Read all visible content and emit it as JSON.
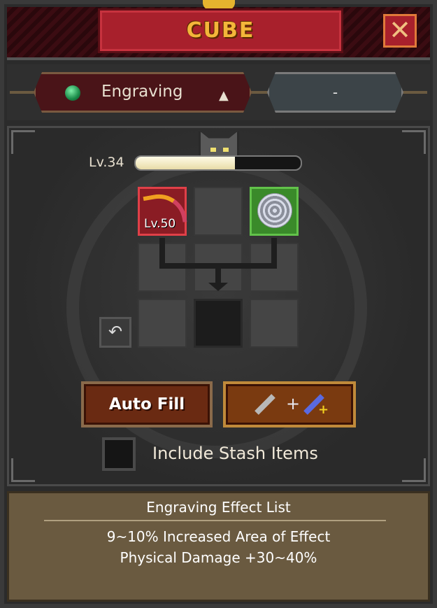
{
  "window": {
    "title": "CUBE",
    "close_icon": "close-icon"
  },
  "selector": {
    "mode_label": "Engraving",
    "mode_icon": "green-gem-icon",
    "mode_arrow": "▲",
    "secondary_label": "-"
  },
  "cube": {
    "level_label": "Lv.34",
    "xp_fraction": 0.6
  },
  "grid": {
    "slot1_item": "bow-icon",
    "slot1_level": "Lv.50",
    "slot3_item": "web-icon"
  },
  "buttons": {
    "auto_fill": "Auto Fill",
    "combine_icon": "sword-combine-icon",
    "undo_icon": "undo-arrow-icon"
  },
  "include_stash": {
    "label": "Include Stash Items",
    "checked": false
  },
  "effects": {
    "title": "Engraving Effect List",
    "lines": [
      "9~10% Increased Area of Effect",
      "Physical Damage +30~40%"
    ]
  },
  "colors": {
    "accent_red": "#a8202c",
    "title_gold": "#f4b53a",
    "item_red": "#8a1c24",
    "item_green": "#3a8a2a"
  }
}
